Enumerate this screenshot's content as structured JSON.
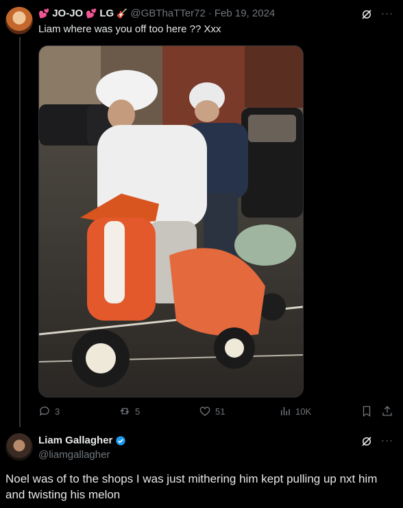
{
  "tweet1": {
    "display_name": "JO-JO",
    "display_name_2": "LG",
    "handle": "@GBThaTTer72",
    "separator": "·",
    "date": "Feb 19, 2024",
    "text": "Liam where was you off too here ?? Xxx",
    "emoji_1": "💕",
    "emoji_2": "💕",
    "emoji_3": "🎸"
  },
  "actions": {
    "replies": "3",
    "reposts": "5",
    "likes": "51",
    "views": "10K"
  },
  "tweet2": {
    "display_name": "Liam Gallagher",
    "handle": "@liamgallagher",
    "text": "Noel was of to the shops I was just mithering him kept pulling up nxt him and twisting his melon"
  },
  "ui": {
    "more_glyph": "···"
  },
  "icons": [
    "grok-icon",
    "more-icon",
    "reply-icon",
    "repost-icon",
    "like-icon",
    "views-icon",
    "bookmark-icon",
    "share-icon",
    "verified-badge-icon"
  ],
  "colors": {
    "background": "#000000",
    "text": "#e7e9ea",
    "muted": "#71767b",
    "verified": "#1d9bf0",
    "heart": "#f91880"
  }
}
